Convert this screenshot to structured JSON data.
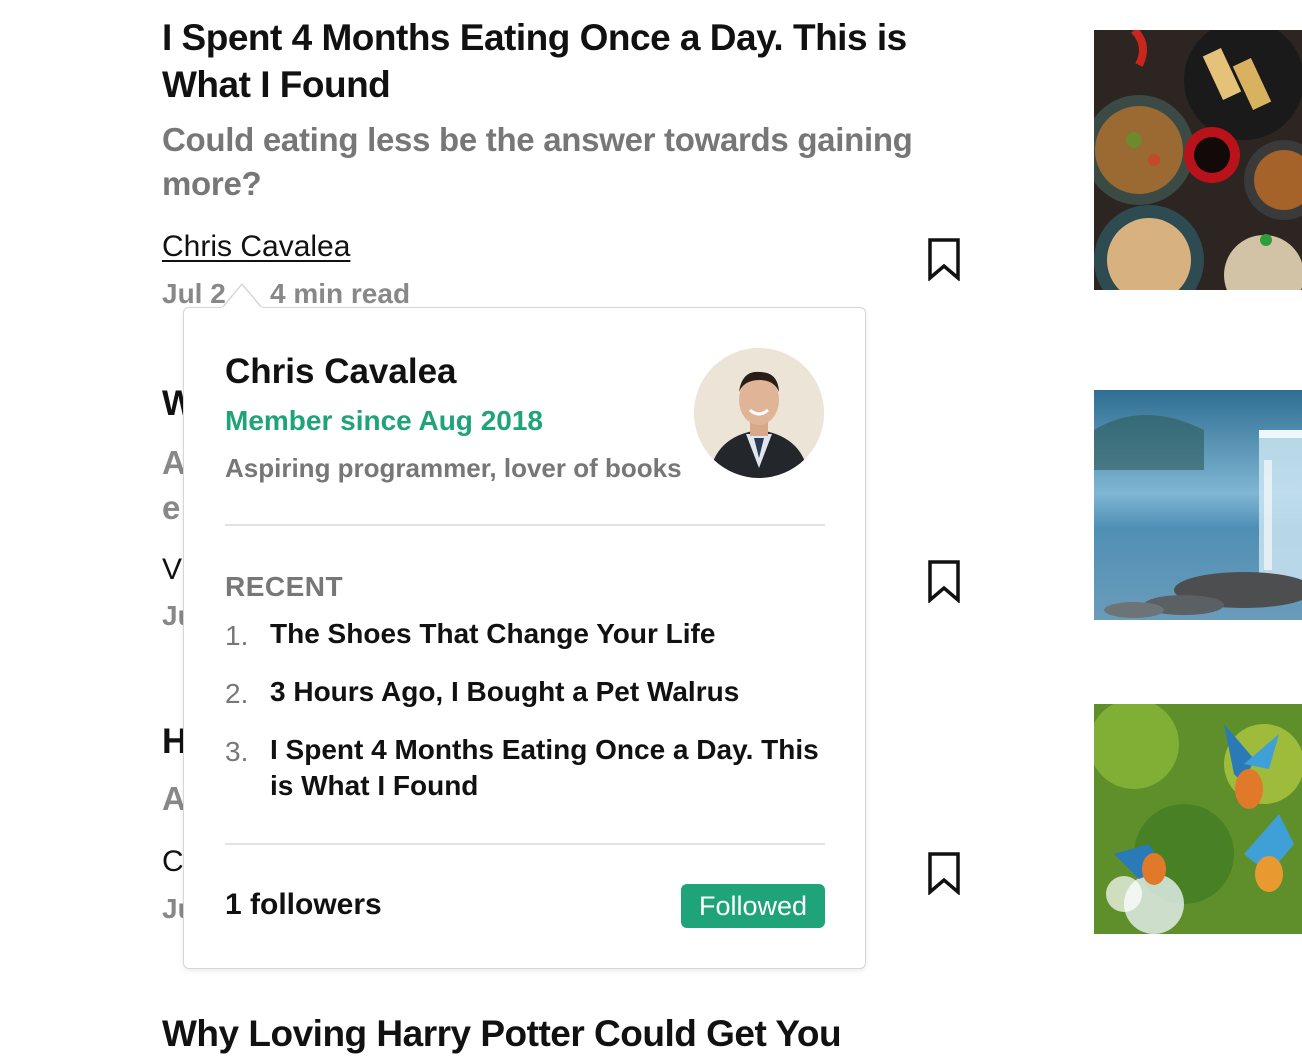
{
  "articles": [
    {
      "title_line1": "I Spent 4 Months Eating Once a Day. This is",
      "title_line2": "What I Found",
      "subtitle_line1": "Could eating less be the answer towards gaining",
      "subtitle_line2": "more?",
      "author": "Chris Cavalea",
      "date_prefix": "Jul 2",
      "read_time": "4 min read"
    },
    {
      "title_char": "W",
      "subtitle_char1": "A",
      "subtitle_char2": "e",
      "author_char": "V",
      "meta_char": "Ju"
    },
    {
      "title_char": "H",
      "subtitle_char1": "A",
      "author_char": "C",
      "meta_char": "Ju"
    },
    {
      "title_partial": "Why Loving Harry Potter Could Get You"
    }
  ],
  "popover": {
    "name": "Chris Cavalea",
    "member_since": "Member since Aug 2018",
    "bio": "Aspiring programmer, lover of books",
    "recent_label": "RECENT",
    "recent": [
      {
        "num": "1.",
        "title": "The Shoes That Change Your Life"
      },
      {
        "num": "2.",
        "title": "3 Hours Ago, I Bought a Pet Walrus"
      },
      {
        "num": "3.",
        "title_line1": "I Spent 4 Months Eating Once a Day. This",
        "title_line2": "is What I Found"
      }
    ],
    "followers": "1 followers",
    "follow_button": "Followed"
  },
  "icons": {
    "bookmark": "bookmark-icon"
  },
  "colors": {
    "accent_green": "#1ea478",
    "muted_text": "#777777"
  }
}
